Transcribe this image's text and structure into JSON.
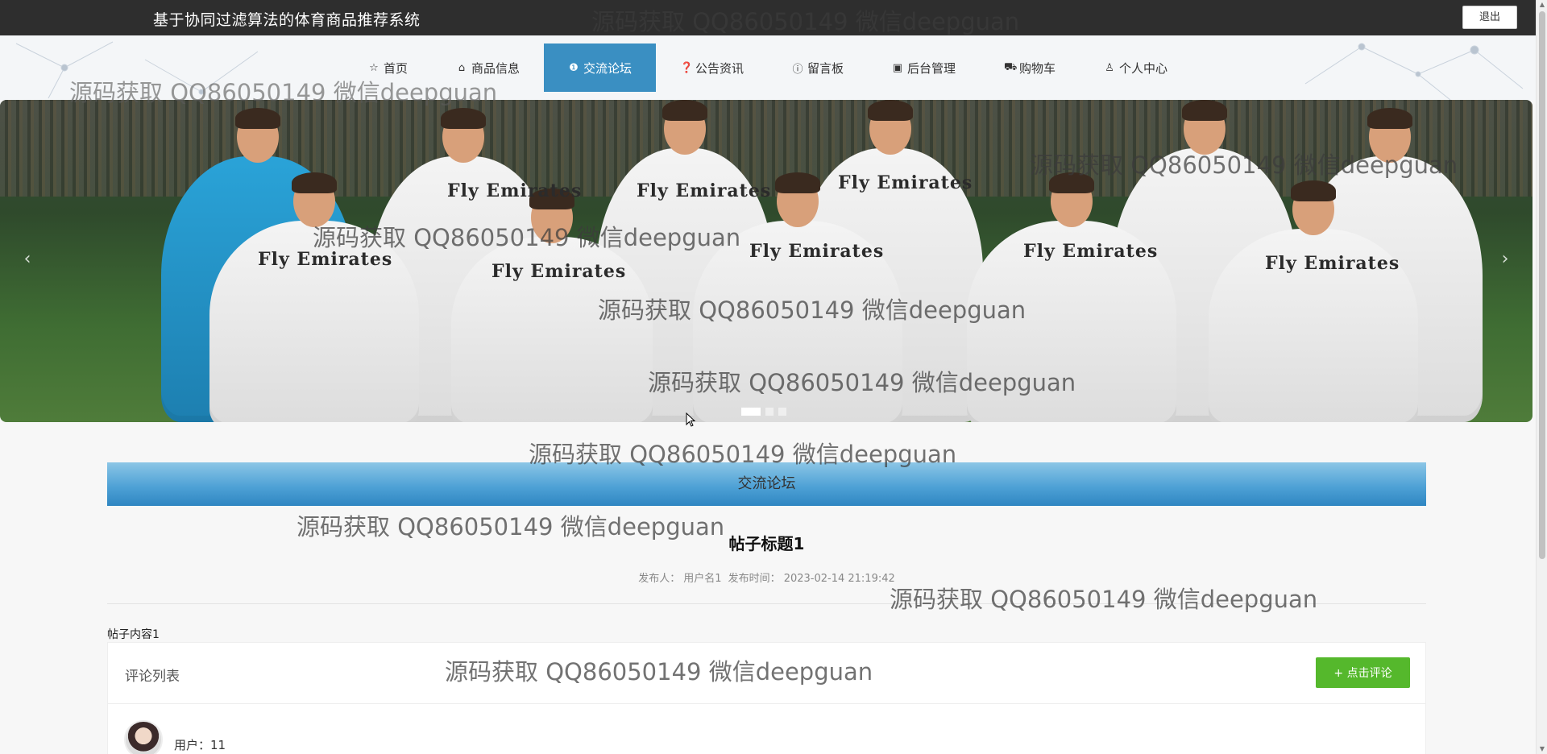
{
  "header": {
    "title": "基于协同过滤算法的体育商品推荐系统",
    "logout_label": "退出"
  },
  "nav": {
    "items": [
      {
        "label": "首页",
        "icon": "star-icon"
      },
      {
        "label": "商品信息",
        "icon": "bag-icon"
      },
      {
        "label": "交流论坛",
        "icon": "info-circle-icon",
        "active": true
      },
      {
        "label": "公告资讯",
        "icon": "question-circle-icon"
      },
      {
        "label": "留言板",
        "icon": "info-circle-icon"
      },
      {
        "label": "后台管理",
        "icon": "briefcase-icon"
      },
      {
        "label": "购物车",
        "icon": "cart-icon"
      },
      {
        "label": "个人中心",
        "icon": "user-icon"
      }
    ]
  },
  "banner": {
    "sponsor_text": "Fly Emirates",
    "prev_glyph": "‹",
    "next_glyph": "›",
    "slide_count": 3,
    "active_slide": 1
  },
  "section": {
    "title": "交流论坛"
  },
  "post": {
    "title": "帖子标题1",
    "author_label": "发布人：",
    "author": "用户名1",
    "time_label": "发布时间：",
    "time": "2023-02-14 21:19:42",
    "content": "帖子内容1"
  },
  "comments": {
    "title": "评论列表",
    "add_button": "+ 点击评论",
    "items": [
      {
        "user_label": "用户：",
        "user": "11"
      }
    ]
  },
  "watermark": {
    "text": "源码获取 QQ86050149 微信deepguan"
  },
  "colors": {
    "topbar": "#2e2e2e",
    "nav_active": "#3a8fc2",
    "section_header": "#4fa2d6",
    "comment_button": "#55b82c"
  }
}
